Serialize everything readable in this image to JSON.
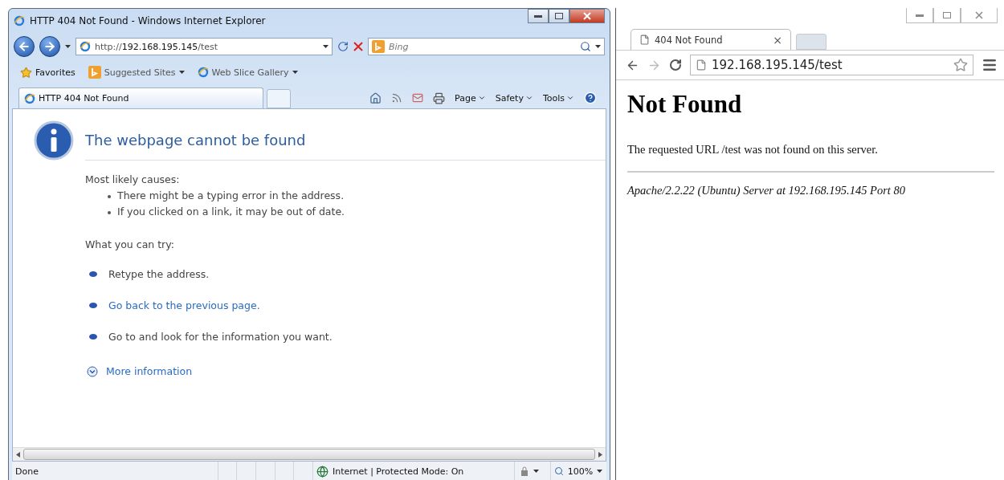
{
  "ie_window": {
    "title": "HTTP 404 Not Found - Windows Internet Explorer",
    "address": "http://**192.168.195.145**/test",
    "search": {
      "placeholder": "Bing"
    },
    "favorites_bar": [
      {
        "label": "Favorites",
        "kind": "favorites"
      },
      {
        "label": "Suggested Sites",
        "kind": "bing"
      },
      {
        "label": "Web Slice Gallery",
        "kind": "ie"
      }
    ],
    "tab": {
      "label": "HTTP 404 Not Found",
      "selected": true
    },
    "command_bar": [
      "Page",
      "Safety",
      "Tools"
    ],
    "page": {
      "heading": "The webpage cannot be found",
      "causes_title": "Most likely causes:",
      "causes": [
        "There might be a typing error in the address.",
        "If you clicked on a link, it may be out of date."
      ],
      "try_title": "What you can try:",
      "tries": [
        {
          "text": "Retype the address.",
          "kind": "text"
        },
        {
          "text": "Go back to the previous page.",
          "kind": "link"
        },
        {
          "text": "Go to  and look for the information you want.",
          "kind": "text"
        }
      ],
      "more": "More information"
    },
    "status_bar": {
      "text": "Done",
      "zone": "Internet | Protected Mode: On",
      "zoom": "100%"
    }
  },
  "chrome_window": {
    "tab": {
      "label": "404 Not Found",
      "selected": true
    },
    "close_glyph": "×",
    "address": "192.168.195.145/test",
    "page": {
      "heading": "Not Found",
      "message": "The requested URL /test was not found on this server.",
      "signature": "Apache/2.2.22 (Ubuntu) Server at 192.168.195.145 Port 80"
    }
  }
}
